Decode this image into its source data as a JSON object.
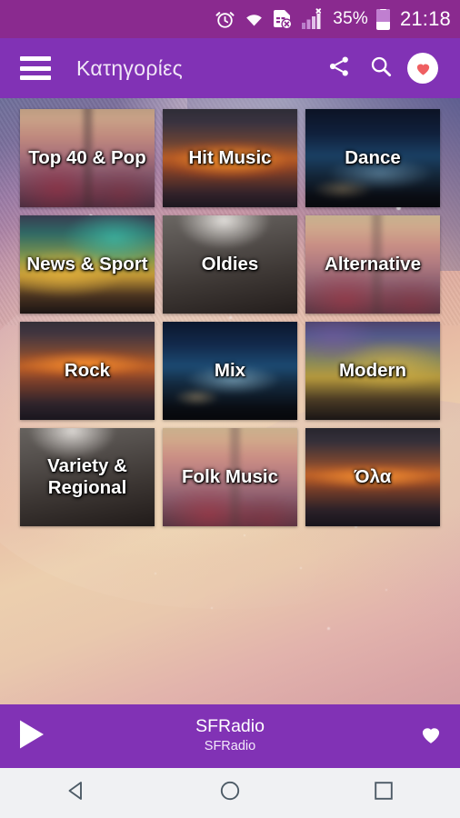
{
  "status_bar": {
    "background": "#8a2a8f",
    "icons": [
      "alarm-icon",
      "wifi-icon",
      "sim-card-error-icon",
      "signal-bars-icon"
    ],
    "battery_percent": "35%",
    "battery_level": 35,
    "clock": "21:18"
  },
  "app_bar": {
    "background": "#8132b5",
    "menu_icon": "hamburger-menu-icon",
    "title": "Κατηγορίες",
    "actions": [
      {
        "name": "share-icon",
        "label": "Share"
      },
      {
        "name": "search-icon",
        "label": "Search"
      },
      {
        "name": "favorites-icon",
        "label": "Favorites"
      }
    ],
    "favorites_heart_color": "#ef5f62"
  },
  "grid": {
    "rows": [
      [
        {
          "label": "Top 40 & Pop",
          "bg": "bg-concert"
        },
        {
          "label": "Hit Music",
          "bg": "bg-sunset-orange"
        },
        {
          "label": "Dance",
          "bg": "bg-nightcity"
        }
      ],
      [
        {
          "label": "News & Sport",
          "bg": "bg-teal"
        },
        {
          "label": "Oldies",
          "bg": "bg-graysoft"
        },
        {
          "label": "Alternative",
          "bg": "bg-crowd2"
        }
      ],
      [
        {
          "label": "Rock",
          "bg": "bg-sunset-rock"
        },
        {
          "label": "Mix",
          "bg": "bg-bluenight"
        },
        {
          "label": "Modern",
          "bg": "bg-modern"
        }
      ],
      [
        {
          "label": "Variety & Regional",
          "bg": "bg-graysoft2"
        },
        {
          "label": "Folk Music",
          "bg": "bg-crowd3"
        },
        {
          "label": "Όλα",
          "bg": "bg-sunset-all"
        }
      ]
    ]
  },
  "player": {
    "background": "#8132b5",
    "play_icon": "play-icon",
    "station_title": "SFRadio",
    "station_subtitle": "SFRadio",
    "favorite_icon": "heart-icon"
  },
  "nav_bar": {
    "background": "#f0f1f3",
    "buttons": [
      {
        "name": "nav-back-button",
        "icon": "triangle-left-icon"
      },
      {
        "name": "nav-home-button",
        "icon": "circle-icon"
      },
      {
        "name": "nav-recents-button",
        "icon": "square-icon"
      }
    ]
  }
}
